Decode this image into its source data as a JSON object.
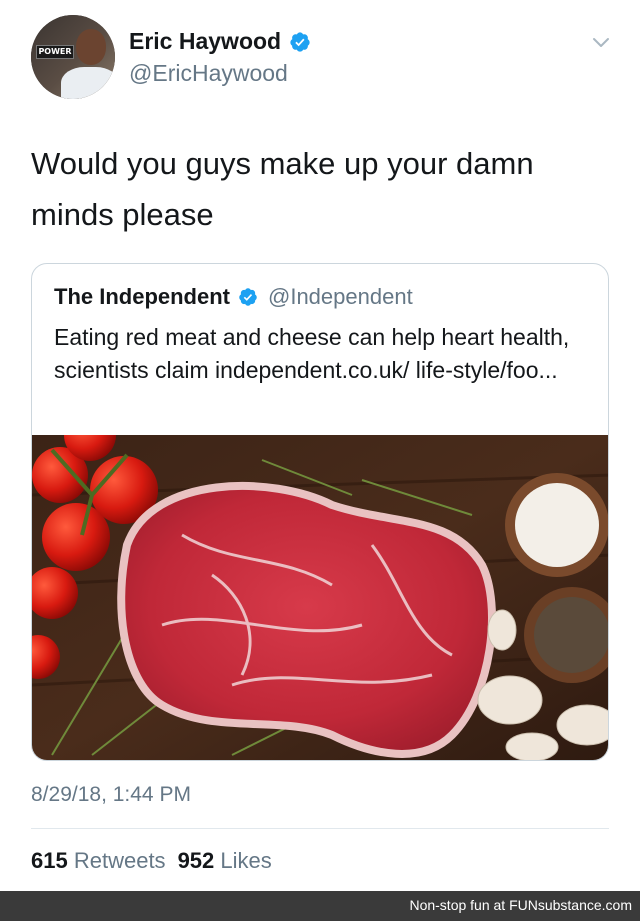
{
  "tweet": {
    "author_name": "Eric Haywood",
    "author_handle": "@EricHaywood",
    "avatar_sign_text": "POWER",
    "text": "Would you guys make up your damn minds please",
    "timestamp": "8/29/18, 1:44 PM",
    "retweets_count": "615",
    "retweets_label": "Retweets",
    "likes_count": "952",
    "likes_label": "Likes"
  },
  "quoted": {
    "author_name": "The Independent",
    "author_handle": "@Independent",
    "text": "Eating red meat and cheese can help heart health, scientists claim independent.co.uk/ life-style/foo..."
  },
  "footer": {
    "text": "Non-stop fun at FUNsubstance.com"
  },
  "colors": {
    "verified_blue": "#1da1f2",
    "secondary_text": "#657786",
    "border": "#ccd6dd"
  },
  "icons": {
    "verified": "verified-badge-icon",
    "menu": "chevron-down-icon"
  }
}
